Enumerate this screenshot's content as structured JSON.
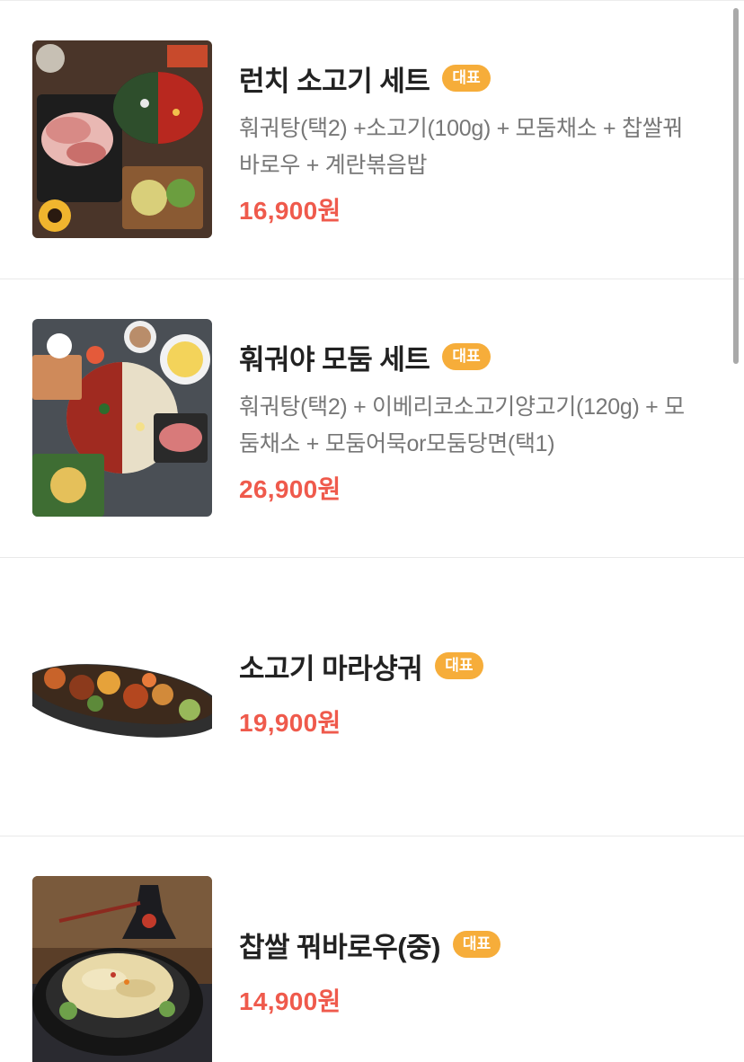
{
  "items": [
    {
      "name": "런치 소고기 세트",
      "badge": "대표",
      "desc_line1": "훠궈탕(택2) +소고기(100g) + 모둠채소 + 찹쌀꿔",
      "desc_line2": "바로우 + 계란볶음밥",
      "price": "16,900원"
    },
    {
      "name": "훠궈야 모둠 세트",
      "badge": "대표",
      "desc_line1": "훠궈탕(택2) + 이베리코소고기양고기(120g) + 모",
      "desc_line2": "둠채소 + 모둠어묵or모둠당면(택1)",
      "price": "26,900원"
    },
    {
      "name": "소고기 마라샹궈",
      "badge": "대표",
      "price": "19,900원"
    },
    {
      "name": "찹쌀 꿔바로우(중)",
      "badge": "대표",
      "price": "14,900원"
    }
  ],
  "colors": {
    "badge": "#f6ad3a",
    "price": "#ef5a4c",
    "title": "#222222",
    "description": "#777777"
  }
}
